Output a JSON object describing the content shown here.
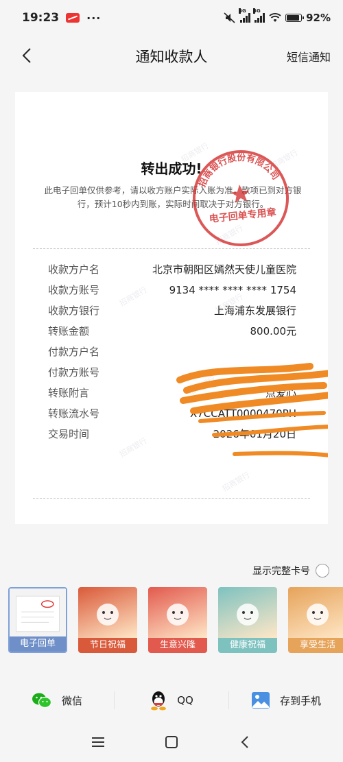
{
  "status_bar": {
    "time": "19:23",
    "more": "···",
    "network_1": "5G",
    "network_2": "5G",
    "battery": "92%"
  },
  "nav": {
    "title": "通知收款人",
    "right_action": "短信通知"
  },
  "receipt": {
    "title": "转出成功!",
    "note": "此电子回单仅供参考，请以收方账户实际入账为准，款项已到对方银行，预计10秒内到账，实际时间取决于对方银行。",
    "stamp": {
      "top_text": "招商银行股份有限公司",
      "bottom_text": "电子回单专用章"
    },
    "watermark": "招商银行",
    "rows": [
      {
        "label": "收款方户名",
        "value": "北京市朝阳区嫣然天使儿童医院"
      },
      {
        "label": "收款方账号",
        "value": "9134 **** **** **** 1754"
      },
      {
        "label": "收款方银行",
        "value": "上海浦东发展银行"
      },
      {
        "label": "转账金额",
        "value": "800.00元"
      },
      {
        "label": "付款方户名",
        "value": ""
      },
      {
        "label": "付款方账号",
        "value": ""
      },
      {
        "label": "转账附言",
        "value": "点爱心"
      },
      {
        "label": "转账流水号",
        "value": "X7CCATT0000470PH"
      },
      {
        "label": "交易时间",
        "value": "2026年01月20日"
      }
    ]
  },
  "show_full_card": {
    "label": "显示完整卡号",
    "checked": false
  },
  "templates": [
    {
      "label": "电子回单",
      "selected": true,
      "color": "#6f8fc8"
    },
    {
      "label": "节日祝福",
      "selected": false,
      "color": "#d95a3a"
    },
    {
      "label": "生意兴隆",
      "selected": false,
      "color": "#e25a4e"
    },
    {
      "label": "健康祝福",
      "selected": false,
      "color": "#7ec2c0"
    },
    {
      "label": "享受生活",
      "selected": false,
      "color": "#e6a35a"
    }
  ],
  "share": [
    {
      "label": "微信",
      "icon": "wechat-icon"
    },
    {
      "label": "QQ",
      "icon": "qq-icon"
    },
    {
      "label": "存到手机",
      "icon": "image-save-icon"
    }
  ]
}
